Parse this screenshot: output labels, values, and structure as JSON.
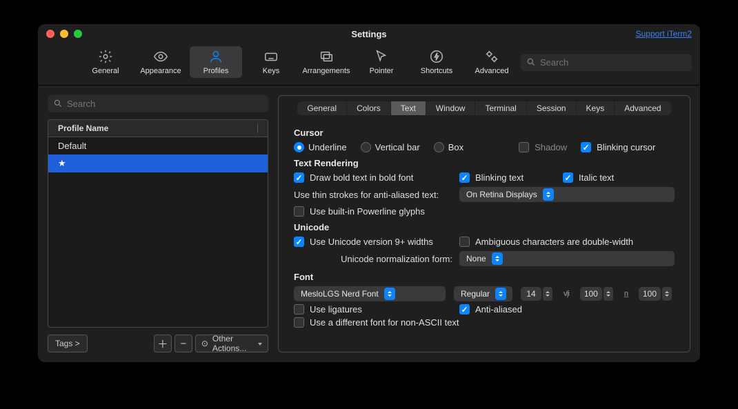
{
  "window": {
    "title": "Settings",
    "support_link": "Support iTerm2"
  },
  "toolbar": {
    "items": [
      {
        "label": "General"
      },
      {
        "label": "Appearance"
      },
      {
        "label": "Profiles"
      },
      {
        "label": "Keys"
      },
      {
        "label": "Arrangements"
      },
      {
        "label": "Pointer"
      },
      {
        "label": "Shortcuts"
      },
      {
        "label": "Advanced"
      }
    ],
    "search_placeholder": "Search"
  },
  "sidebar": {
    "search_placeholder": "Search",
    "header": "Profile Name",
    "rows": [
      {
        "label": "Default"
      },
      {
        "label": "★"
      }
    ],
    "tags_label": "Tags >",
    "other_actions_label": "Other Actions..."
  },
  "tabs": [
    "General",
    "Colors",
    "Text",
    "Window",
    "Terminal",
    "Session",
    "Keys",
    "Advanced"
  ],
  "sections": {
    "cursor": {
      "title": "Cursor",
      "underline": "Underline",
      "vertical": "Vertical bar",
      "box": "Box",
      "shadow": "Shadow",
      "blinking": "Blinking cursor"
    },
    "text_rendering": {
      "title": "Text Rendering",
      "bold": "Draw bold text in bold font",
      "blinking_text": "Blinking text",
      "italic": "Italic text",
      "thin_strokes_label": "Use thin strokes for anti-aliased text:",
      "thin_strokes_value": "On Retina Displays",
      "powerline": "Use built-in Powerline glyphs"
    },
    "unicode": {
      "title": "Unicode",
      "version9": "Use Unicode version 9+ widths",
      "ambiguous": "Ambiguous characters are double-width",
      "normalization_label": "Unicode normalization form:",
      "normalization_value": "None"
    },
    "font": {
      "title": "Font",
      "font_value": "MesloLGS Nerd Font",
      "weight_value": "Regular",
      "size": "14",
      "hspace": "100",
      "vspace": "100",
      "ligatures": "Use ligatures",
      "antialiased": "Anti-aliased",
      "different_font": "Use a different font for non-ASCII text"
    }
  }
}
